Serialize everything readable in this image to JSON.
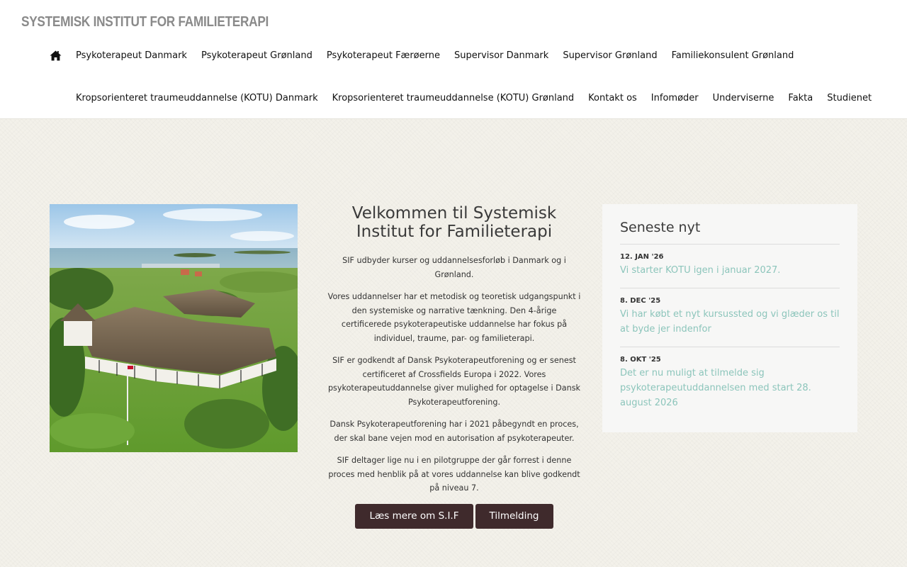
{
  "logo": {
    "text": "SYSTEMISK INSTITUT FOR FAMILIETERAPI"
  },
  "nav": {
    "row1": [
      "Psykoterapeut Danmark",
      "Psykoterapeut Grønland",
      "Psykoterapeut Færøerne",
      "Supervisor Danmark",
      "Supervisor Grønland",
      "Familiekonsulent Grønland"
    ],
    "row2": [
      "Kropsorienteret traumeuddannelse (KOTU) Danmark",
      "Kropsorienteret traumeuddannelse (KOTU) Grønland",
      "Kontakt os",
      "Infomøder",
      "Underviserne",
      "Fakta",
      "Studienet"
    ]
  },
  "intro": {
    "title": "Velkommen til Systemisk Institut for Familieterapi",
    "paragraphs": [
      "SIF udbyder kurser og uddannelsesforløb i Danmark og i Grønland.",
      "Vores uddannelser har et metodisk og teoretisk udgangspunkt i den systemiske og narrative tænkning. Den 4-årige certificerede psykoterapeutiske uddannelse har fokus på individuel, traume, par- og familieterapi.",
      "SIF er godkendt af Dansk Psykoterapeutforening og er senest certificeret af Crossfields Europa i 2022. Vores psykoterapeutuddannelse giver mulighed for optagelse i Dansk Psykoterapeutforening.",
      "Dansk Psykoterapeutforening har i 2021 påbegyndt en proces, der skal bane vejen mod en autorisation af psykoterapeuter.",
      "SIF deltager lige nu i en pilotgruppe der går forrest i denne proces med henblik på at vores uddannelse kan blive godkendt på niveau 7."
    ],
    "buttons": {
      "more": "Læs mere om S.I.F",
      "signup": "Tilmelding"
    }
  },
  "news": {
    "title": "Seneste nyt",
    "items": [
      {
        "date": "12. JAN '26",
        "text": "Vi starter KOTU igen i januar 2027."
      },
      {
        "date": "8. DEC '25",
        "text": "Vi har købt et nyt kursussted og vi glæder os til at byde jer indenfor"
      },
      {
        "date": "8. OKT '25",
        "text": "Det er nu muligt at tilmelde sig psykoterapeutuddannelsen med start 28. august 2026"
      }
    ]
  },
  "icons": {
    "home": "home-icon"
  },
  "colors": {
    "button_bg": "#3f2a2c",
    "news_link": "#8cc5bb",
    "logo": "#8a8a8a"
  }
}
